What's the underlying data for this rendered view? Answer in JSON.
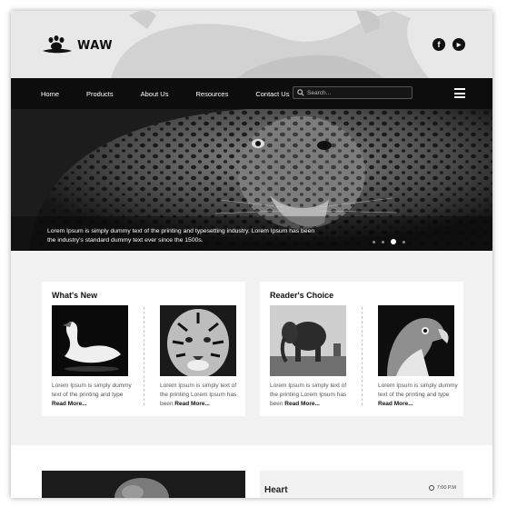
{
  "header": {
    "brand": "WAW",
    "social": [
      {
        "icon": "facebook-icon",
        "glyph": "f"
      },
      {
        "icon": "youtube-icon",
        "glyph": "▶"
      }
    ]
  },
  "nav": {
    "items": [
      "Home",
      "Products",
      "About Us",
      "Resources",
      "Contact Us"
    ],
    "search_placeholder": "Search..."
  },
  "hero": {
    "caption": "Lorem Ipsum is simply dummy text of the printing and typesetting industry. Lorem Ipsum has been the industry's standard dummy text ever since the 1500s.",
    "slides": 4,
    "active_slide": 3
  },
  "cards": [
    {
      "title": "What's New",
      "items": [
        {
          "image": "swan",
          "text": "Lorem Ipsum is simply dummy text of the printing and type",
          "more": "Read More..."
        },
        {
          "image": "tiger",
          "text": "Lorem Ipsum is simply text of the printing Lorem Ipsum has been",
          "more": "Read More..."
        }
      ]
    },
    {
      "title": "Reader's Choice",
      "items": [
        {
          "image": "elephant",
          "text": "Lorem Ipsum is simply text of the printing Lorem Ipsum has been",
          "more": "Read More..."
        },
        {
          "image": "eagle",
          "text": "Lorem Ipsum is simply dummy text of the printing and type",
          "more": "Read More..."
        }
      ]
    }
  ],
  "bottom": {
    "title": "Heart",
    "time": "7:00 P.M"
  },
  "colors": {
    "nav_bg": "#0d0d0d",
    "page_bg": "#f2f2f2",
    "card_bg": "#ffffff"
  }
}
